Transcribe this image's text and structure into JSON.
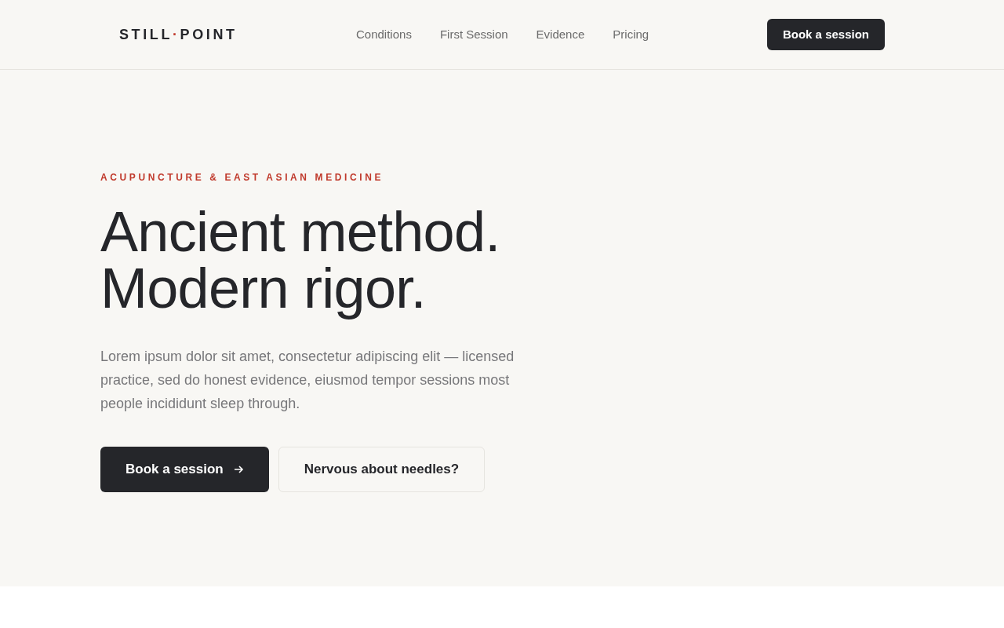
{
  "header": {
    "logo": {
      "left": "STILL",
      "separator": "·",
      "right": "POINT"
    },
    "nav": [
      "Conditions",
      "First Session",
      "Evidence",
      "Pricing"
    ],
    "cta": "Book a session"
  },
  "hero": {
    "eyebrow": "ACUPUNCTURE & EAST ASIAN MEDICINE",
    "headline": [
      "Ancient method.",
      "Modern rigor."
    ],
    "body": "Lorem ipsum dolor sit amet, consectetur adipiscing elit — licensed practice, sed do honest evidence, eiusmod tempor sessions most people incididunt sleep through.",
    "buttons": [
      {
        "label": "Book a session",
        "kind": "primary"
      },
      {
        "label": "Nervous about needles?",
        "kind": "secondary"
      }
    ]
  }
}
